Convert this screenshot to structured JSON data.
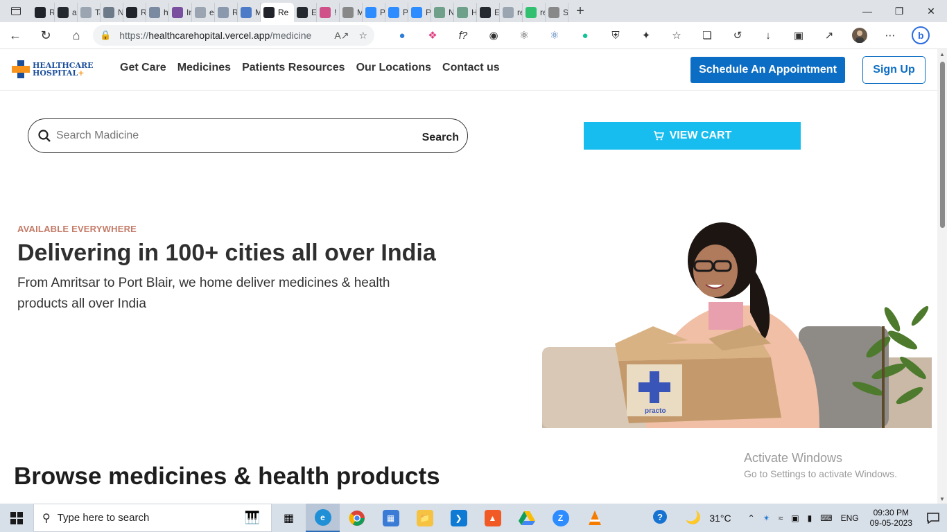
{
  "browser": {
    "tabs": [
      {
        "label": "Re",
        "color": "#20232a"
      },
      {
        "label": "as",
        "color": "#24292f"
      },
      {
        "label": "Ta",
        "color": "#9aa5b1"
      },
      {
        "label": "N",
        "color": "#6c7a89"
      },
      {
        "label": "Re",
        "color": "#20232a"
      },
      {
        "label": "ht",
        "color": "#7a8aa0"
      },
      {
        "label": "In",
        "color": "#7b4fa0"
      },
      {
        "label": "er",
        "color": "#9aa5b1"
      },
      {
        "label": "Re",
        "color": "#8a99ad"
      },
      {
        "label": "M",
        "color": "#4d7bc8"
      },
      {
        "label": "Re",
        "color": "#20232a",
        "active": true
      },
      {
        "label": "Ec",
        "color": "#24292f"
      },
      {
        "label": "! S",
        "color": "#d0508a"
      },
      {
        "label": "M",
        "color": "#888888"
      },
      {
        "label": "Pc",
        "color": "#2d8cff"
      },
      {
        "label": "Pc",
        "color": "#2d8cff"
      },
      {
        "label": "Pc",
        "color": "#2d8cff"
      },
      {
        "label": "N",
        "color": "#6fa08a"
      },
      {
        "label": "Hc",
        "color": "#6fa08a"
      },
      {
        "label": "Ec",
        "color": "#24292f"
      },
      {
        "label": "re",
        "color": "#9aa5b1"
      },
      {
        "label": "re",
        "color": "#30c070"
      },
      {
        "label": "Sc",
        "color": "#888888"
      }
    ],
    "url_prefix": "https://",
    "url_host": "healthcarehopital.vercel.app",
    "url_path": "/medicine"
  },
  "site": {
    "logo_line1": "HEALTHCARE",
    "logo_line2": "HOSPITAL",
    "logo_plus": "+",
    "nav": [
      "Get Care",
      "Medicines",
      "Patients Resources",
      "Our Locations",
      "Contact us"
    ],
    "appointment_label": "Schedule An Appointment",
    "signup_label": "Sign Up"
  },
  "search": {
    "placeholder": "Search Madicine",
    "button_label": "Search"
  },
  "cart": {
    "label": "VIEW CART"
  },
  "hero": {
    "eyebrow": "AVAILABLE EVERYWHERE",
    "title": "Delivering in 100+ cities all over India",
    "subtitle": "From Amritsar to Port Blair, we home deliver medicines & health products all over India",
    "box_brand": "practo"
  },
  "browse": {
    "title": "Browse medicines & health products"
  },
  "watermark": {
    "line1": "Activate Windows",
    "line2": "Go to Settings to activate Windows."
  },
  "taskbar": {
    "search_placeholder": "Type here to search",
    "weather": "31°C",
    "language": "ENG",
    "time": "09:30 PM",
    "date": "09-05-2023"
  }
}
